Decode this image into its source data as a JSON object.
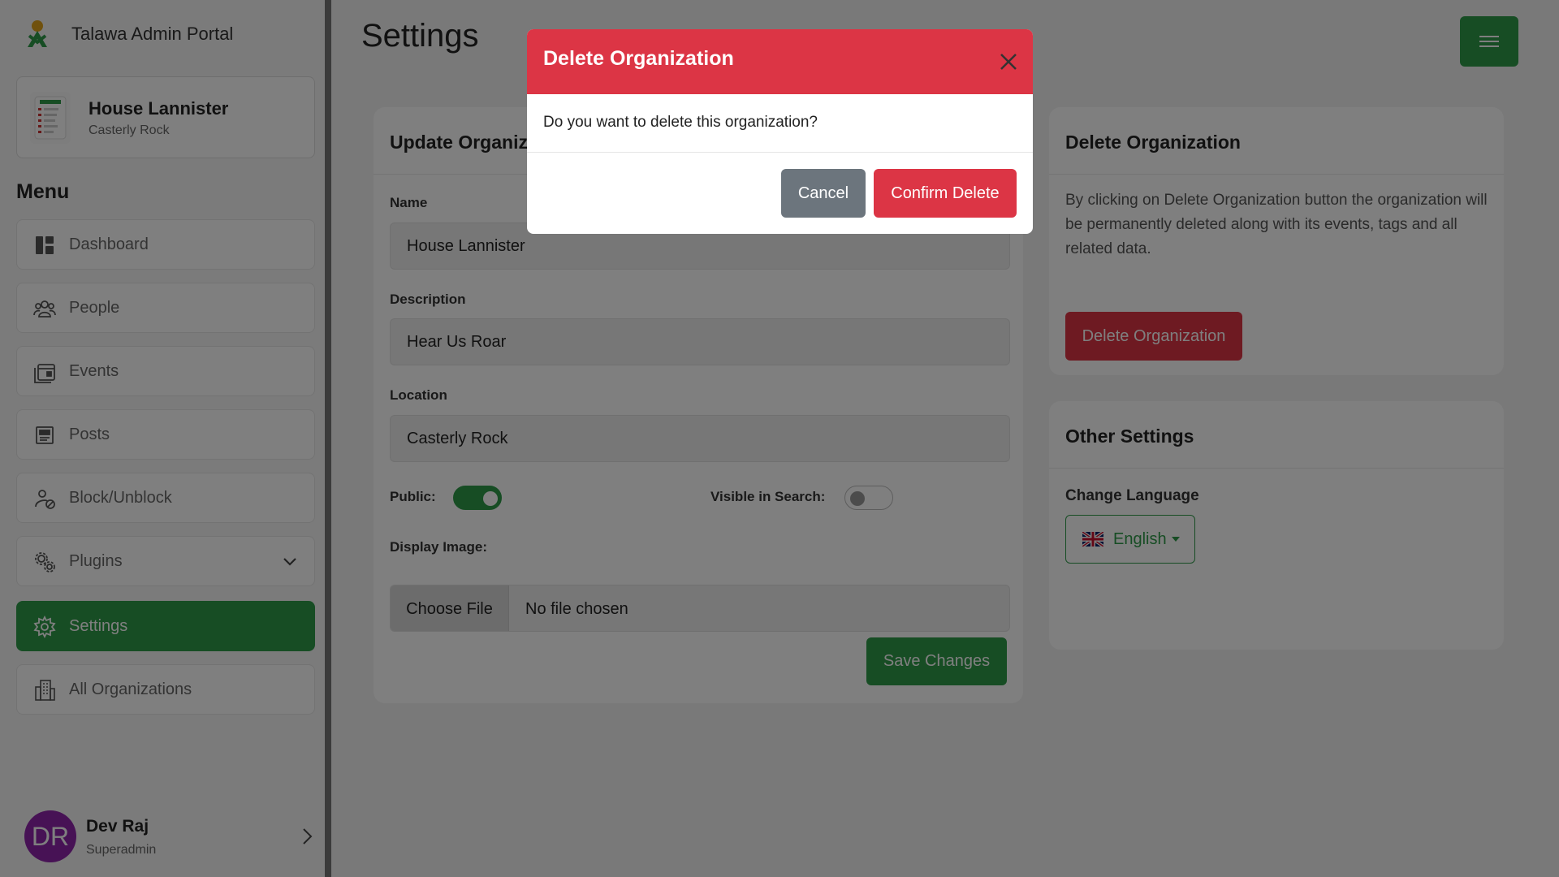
{
  "app": {
    "brand_name": "Talawa Admin Portal"
  },
  "org": {
    "name": "House Lannister",
    "location": "Casterly Rock"
  },
  "menu": {
    "title": "Menu",
    "items": [
      {
        "label": "Dashboard",
        "icon": "dashboard-icon"
      },
      {
        "label": "People",
        "icon": "people-icon"
      },
      {
        "label": "Events",
        "icon": "events-icon"
      },
      {
        "label": "Posts",
        "icon": "posts-icon"
      },
      {
        "label": "Block/Unblock",
        "icon": "block-user-icon"
      },
      {
        "label": "Plugins",
        "icon": "plugins-icon"
      },
      {
        "label": "Settings",
        "icon": "settings-icon",
        "active": true
      },
      {
        "label": "All Organizations",
        "icon": "organizations-icon"
      }
    ]
  },
  "user": {
    "initials": "DR",
    "name": "Dev Raj",
    "role": "Superadmin"
  },
  "page": {
    "title": "Settings"
  },
  "update_card": {
    "title": "Update Organization",
    "name_label": "Name",
    "name_value": "House Lannister",
    "description_label": "Description",
    "description_value": "Hear Us Roar",
    "location_label": "Location",
    "location_value": "Casterly Rock",
    "public_label": "Public:",
    "public_on": true,
    "visible_label": "Visible in Search:",
    "visible_on": false,
    "display_image_label": "Display Image:",
    "choose_file_label": "Choose File",
    "no_file_text": "No file chosen",
    "save_label": "Save Changes"
  },
  "delete_card": {
    "title": "Delete Organization",
    "description": "By clicking on Delete Organization button the organization will be permanently deleted along with its events, tags and all related data.",
    "button_label": "Delete Organization"
  },
  "other_card": {
    "title": "Other Settings",
    "language_label": "Change Language",
    "language_value": "English"
  },
  "modal": {
    "title": "Delete Organization",
    "body": "Do you want to delete this organization?",
    "cancel_label": "Cancel",
    "confirm_label": "Confirm Delete"
  },
  "colors": {
    "primary_green": "#2e9a49",
    "danger_red": "#dc3545",
    "secondary_gray": "#6c757d",
    "avatar_purple": "#8e24aa"
  }
}
